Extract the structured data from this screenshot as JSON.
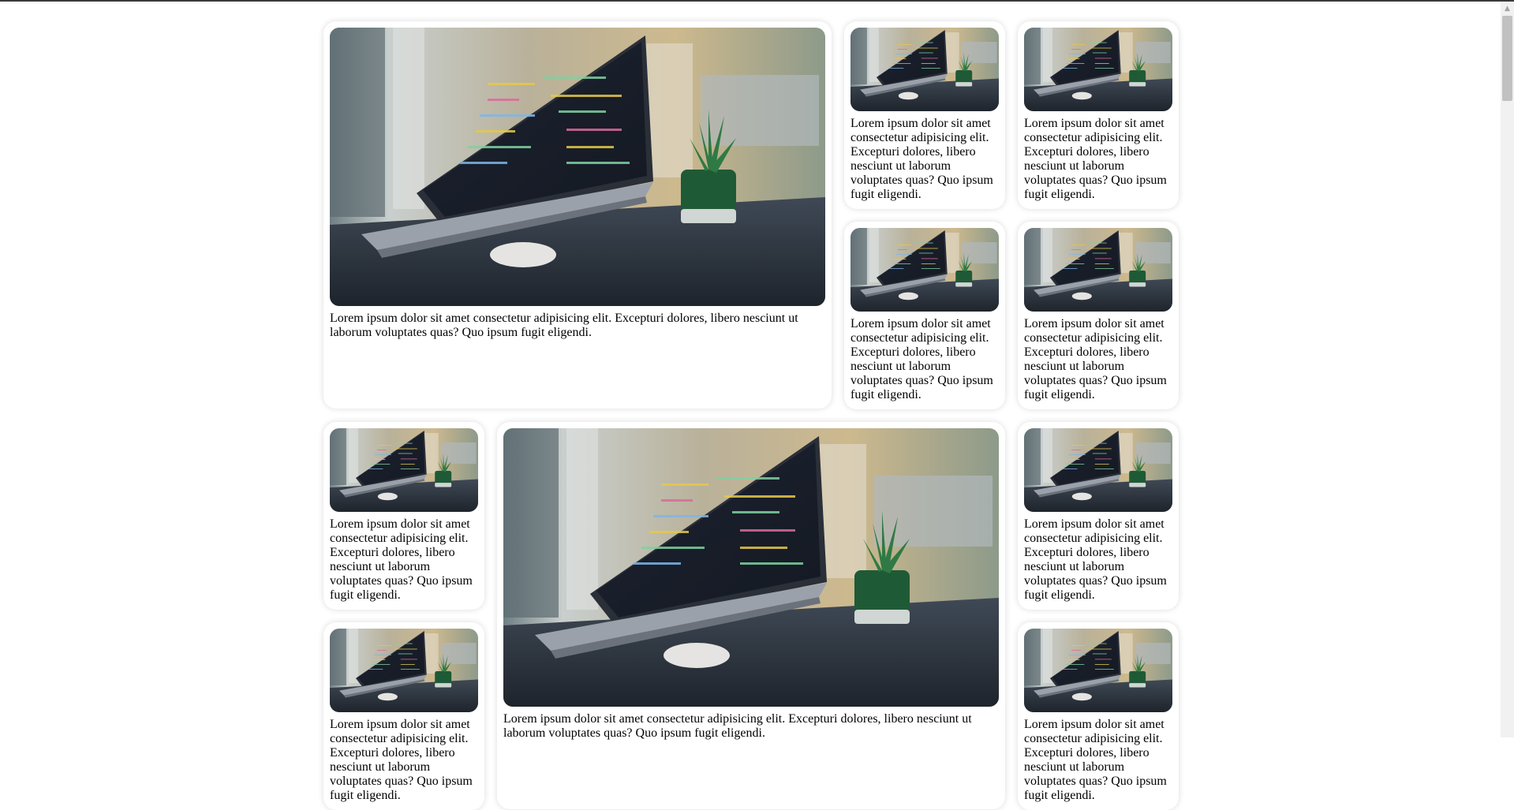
{
  "page": {
    "card_text": "Lorem ipsum dolor sit amet consectetur adipisicing elit. Excepturi dolores, libero nesciunt ut laborum voluptates quas? Quo ipsum fugit eligendi.",
    "image_subject": "laptop-on-desk-with-plant-photo"
  },
  "cards": [
    {
      "size": "large",
      "text": "Lorem ipsum dolor sit amet consectetur adipisicing elit. Excepturi dolores, libero nesciunt ut laborum voluptates quas? Quo ipsum fugit eligendi."
    },
    {
      "size": "small",
      "text": "Lorem ipsum dolor sit amet consectetur adipisicing elit. Excepturi dolores, libero nesciunt ut laborum voluptates quas? Quo ipsum fugit eligendi."
    },
    {
      "size": "small",
      "text": "Lorem ipsum dolor sit amet consectetur adipisicing elit. Excepturi dolores, libero nesciunt ut laborum voluptates quas? Quo ipsum fugit eligendi."
    },
    {
      "size": "small",
      "text": "Lorem ipsum dolor sit amet consectetur adipisicing elit. Excepturi dolores, libero nesciunt ut laborum voluptates quas? Quo ipsum fugit eligendi."
    },
    {
      "size": "small",
      "text": "Lorem ipsum dolor sit amet consectetur adipisicing elit. Excepturi dolores, libero nesciunt ut laborum voluptates quas? Quo ipsum fugit eligendi."
    },
    {
      "size": "small",
      "text": "Lorem ipsum dolor sit amet consectetur adipisicing elit. Excepturi dolores, libero nesciunt ut laborum voluptates quas? Quo ipsum fugit eligendi."
    },
    {
      "size": "large",
      "text": "Lorem ipsum dolor sit amet consectetur adipisicing elit. Excepturi dolores, libero nesciunt ut laborum voluptates quas? Quo ipsum fugit eligendi."
    },
    {
      "size": "small",
      "text": "Lorem ipsum dolor sit amet consectetur adipisicing elit. Excepturi dolores, libero nesciunt ut laborum voluptates quas? Quo ipsum fugit eligendi."
    },
    {
      "size": "small",
      "text": "Lorem ipsum dolor sit amet consectetur adipisicing elit. Excepturi dolores, libero nesciunt ut laborum voluptates quas? Quo ipsum fugit eligendi."
    },
    {
      "size": "small",
      "text": "Lorem ipsum dolor sit amet consectetur adipisicing elit. Excepturi dolores, libero nesciunt ut laborum voluptates quas? Quo ipsum fugit eligendi."
    }
  ],
  "scrollbar": {
    "up_arrow_icon": "triangle-up-icon"
  }
}
